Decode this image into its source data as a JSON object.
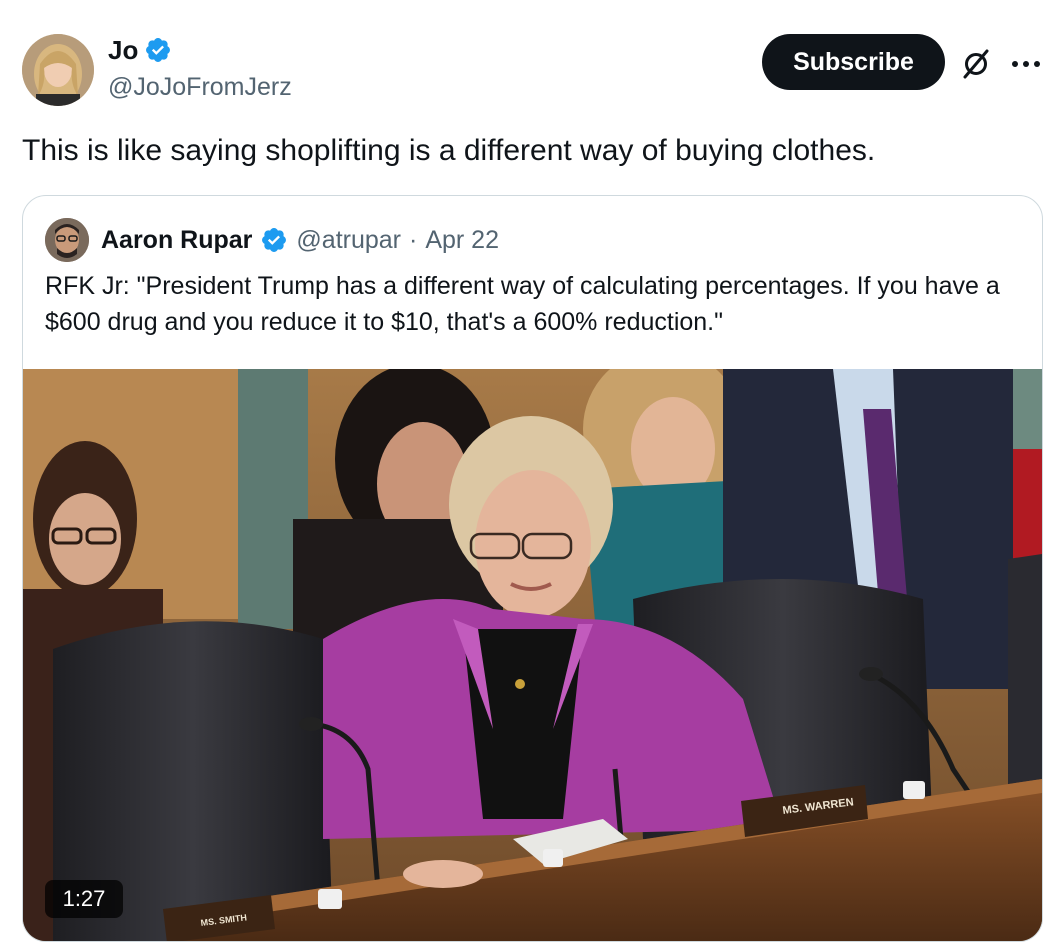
{
  "author": {
    "name": "Jo",
    "handle": "@JoJoFromJerz",
    "verified_icon": "verified-badge-icon",
    "avatar_icon": "profile-photo"
  },
  "actions": {
    "subscribe_label": "Subscribe",
    "grok_icon": "grok-icon",
    "more_icon": "more-horizontal-icon"
  },
  "tweet": {
    "text": "This is like saying shoplifting is a different way of buying clothes."
  },
  "quoted": {
    "name": "Aaron Rupar",
    "handle": "@atrupar",
    "dot": "·",
    "date": "Apr 22",
    "text": "RFK Jr: \"President Trump has a different way of calculating percentages. If you have a $600 drug and you reduce it to $10, that's a 600% reduction.\"",
    "video": {
      "duration": "1:27",
      "nameplate_main": "MS. WARREN",
      "nameplate_left": "MS. SMITH"
    }
  },
  "colors": {
    "verified": "#1d9bf0",
    "text_primary": "#0f1419",
    "text_secondary": "#536471",
    "border": "#cfd9de",
    "subscribe_bg": "#0f1419"
  }
}
